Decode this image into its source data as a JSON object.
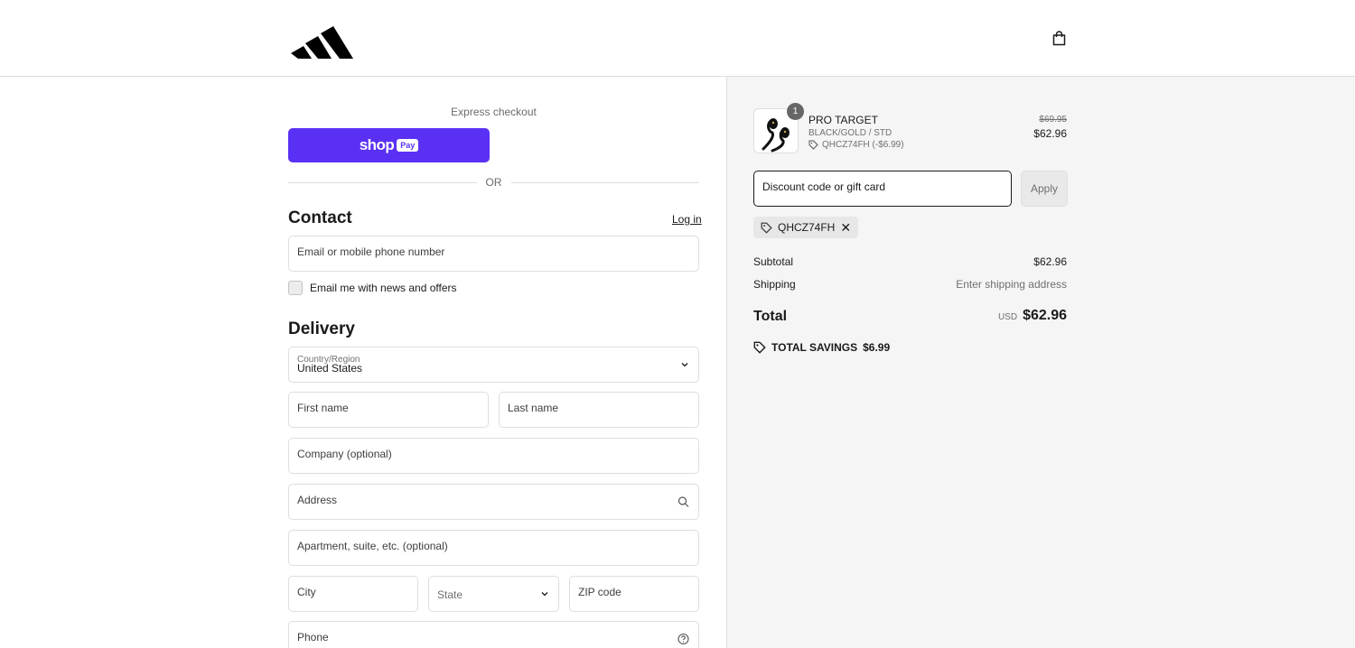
{
  "corner_mark": "ᑦᑊ",
  "header": {
    "logo": "adidas-logo",
    "bag_icon": "shopping-bag-icon"
  },
  "express": {
    "label": "Express checkout",
    "shoppay_word": "shop",
    "shoppay_pay": "Pay",
    "or_text": "OR"
  },
  "contact": {
    "title": "Contact",
    "login_link": "Log in",
    "email_placeholder": "Email or mobile phone number",
    "newsletter_label": "Email me with news and offers"
  },
  "delivery": {
    "title": "Delivery",
    "country_label": "Country/Region",
    "country_value": "United States",
    "first_name": "First name",
    "last_name": "Last name",
    "company": "Company (optional)",
    "address": "Address",
    "apartment": "Apartment, suite, etc. (optional)",
    "city": "City",
    "state": "State",
    "zip": "ZIP code",
    "phone": "Phone"
  },
  "order": {
    "quantity": "1",
    "product_name": "PRO TARGET",
    "variant": "BLACK/GOLD / STD",
    "discount_line": "QHCZ74FH (-$6.99)",
    "price_original": "$69.95",
    "price_current": "$62.96",
    "discount_placeholder": "Discount code or gift card",
    "apply_label": "Apply",
    "applied_code": "QHCZ74FH",
    "subtotal_label": "Subtotal",
    "subtotal_value": "$62.96",
    "shipping_label": "Shipping",
    "shipping_value": "Enter shipping address",
    "total_label": "Total",
    "total_currency": "USD",
    "total_value": "$62.96",
    "savings_label": "TOTAL SAVINGS",
    "savings_value": "$6.99"
  },
  "colors": {
    "shoppay": "#5a31f4",
    "summary_bg": "#f5f5f5",
    "border": "#dedede"
  }
}
